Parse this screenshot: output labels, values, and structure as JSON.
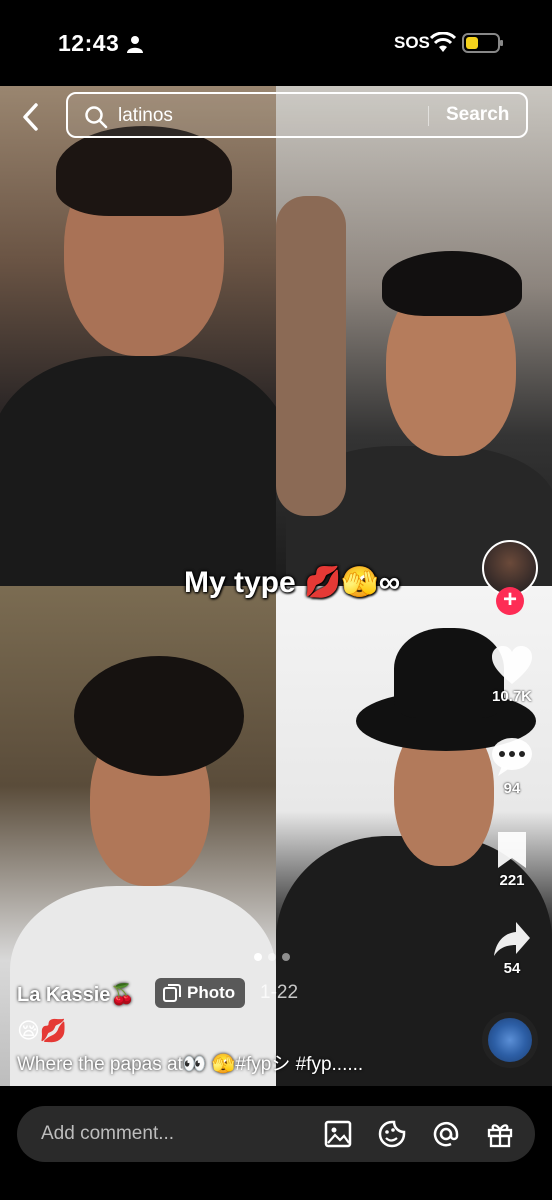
{
  "status": {
    "time": "12:43",
    "sos": "SOS"
  },
  "search": {
    "query": "latinos",
    "button_label": "Search"
  },
  "post": {
    "overlay_text": "My type 💋🫣∞",
    "username": "La Kassie🍒",
    "badge_label": "Photo",
    "date": "1-22",
    "emojis": "😪💋",
    "caption": "Where the papas at👀 🫣#fypシ #fyp......",
    "carousel_dots": 3,
    "carousel_active": 0
  },
  "actions": {
    "likes": "10.7K",
    "comments": "94",
    "saves": "221",
    "shares": "54"
  },
  "comment_bar": {
    "placeholder": "Add comment..."
  },
  "colors": {
    "follow_accent": "#fe2c55",
    "battery_low": "#f5d21c"
  }
}
